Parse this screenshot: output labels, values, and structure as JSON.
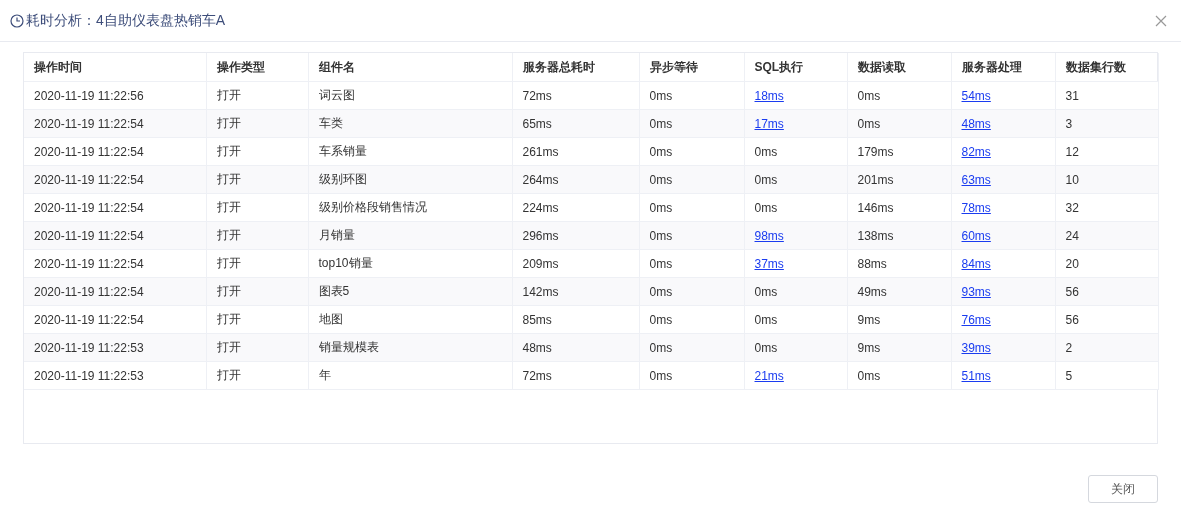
{
  "dialog": {
    "title": "耗时分析：4自助仪表盘热销车A"
  },
  "table": {
    "columns": [
      "操作时间",
      "操作类型",
      "组件名",
      "服务器总耗时",
      "异步等待",
      "SQL执行",
      "数据读取",
      "服务器处理",
      "数据集行数"
    ],
    "rows": [
      {
        "cells": [
          {
            "text": "2020-11-19 11:22:56",
            "link": false
          },
          {
            "text": "打开",
            "link": false
          },
          {
            "text": "词云图",
            "link": false
          },
          {
            "text": "72ms",
            "link": false
          },
          {
            "text": "0ms",
            "link": false
          },
          {
            "text": "18ms",
            "link": true
          },
          {
            "text": "0ms",
            "link": false
          },
          {
            "text": "54ms",
            "link": true
          },
          {
            "text": "31",
            "link": false
          }
        ]
      },
      {
        "cells": [
          {
            "text": "2020-11-19 11:22:54",
            "link": false
          },
          {
            "text": "打开",
            "link": false
          },
          {
            "text": "车类",
            "link": false
          },
          {
            "text": "65ms",
            "link": false
          },
          {
            "text": "0ms",
            "link": false
          },
          {
            "text": "17ms",
            "link": true
          },
          {
            "text": "0ms",
            "link": false
          },
          {
            "text": "48ms",
            "link": true
          },
          {
            "text": "3",
            "link": false
          }
        ]
      },
      {
        "cells": [
          {
            "text": "2020-11-19 11:22:54",
            "link": false
          },
          {
            "text": "打开",
            "link": false
          },
          {
            "text": "车系销量",
            "link": false
          },
          {
            "text": "261ms",
            "link": false
          },
          {
            "text": "0ms",
            "link": false
          },
          {
            "text": "0ms",
            "link": false
          },
          {
            "text": "179ms",
            "link": false
          },
          {
            "text": "82ms",
            "link": true
          },
          {
            "text": "12",
            "link": false
          }
        ]
      },
      {
        "cells": [
          {
            "text": "2020-11-19 11:22:54",
            "link": false
          },
          {
            "text": "打开",
            "link": false
          },
          {
            "text": "级别环图",
            "link": false
          },
          {
            "text": "264ms",
            "link": false
          },
          {
            "text": "0ms",
            "link": false
          },
          {
            "text": "0ms",
            "link": false
          },
          {
            "text": "201ms",
            "link": false
          },
          {
            "text": "63ms",
            "link": true
          },
          {
            "text": "10",
            "link": false
          }
        ]
      },
      {
        "cells": [
          {
            "text": "2020-11-19 11:22:54",
            "link": false
          },
          {
            "text": "打开",
            "link": false
          },
          {
            "text": "级别价格段销售情况",
            "link": false
          },
          {
            "text": "224ms",
            "link": false
          },
          {
            "text": "0ms",
            "link": false
          },
          {
            "text": "0ms",
            "link": false
          },
          {
            "text": "146ms",
            "link": false
          },
          {
            "text": "78ms",
            "link": true
          },
          {
            "text": "32",
            "link": false
          }
        ]
      },
      {
        "cells": [
          {
            "text": "2020-11-19 11:22:54",
            "link": false
          },
          {
            "text": "打开",
            "link": false
          },
          {
            "text": "月销量",
            "link": false
          },
          {
            "text": "296ms",
            "link": false
          },
          {
            "text": "0ms",
            "link": false
          },
          {
            "text": "98ms",
            "link": true
          },
          {
            "text": "138ms",
            "link": false
          },
          {
            "text": "60ms",
            "link": true
          },
          {
            "text": "24",
            "link": false
          }
        ]
      },
      {
        "cells": [
          {
            "text": "2020-11-19 11:22:54",
            "link": false
          },
          {
            "text": "打开",
            "link": false
          },
          {
            "text": "top10销量",
            "link": false
          },
          {
            "text": "209ms",
            "link": false
          },
          {
            "text": "0ms",
            "link": false
          },
          {
            "text": "37ms",
            "link": true
          },
          {
            "text": "88ms",
            "link": false
          },
          {
            "text": "84ms",
            "link": true
          },
          {
            "text": "20",
            "link": false
          }
        ]
      },
      {
        "cells": [
          {
            "text": "2020-11-19 11:22:54",
            "link": false
          },
          {
            "text": "打开",
            "link": false
          },
          {
            "text": "图表5",
            "link": false
          },
          {
            "text": "142ms",
            "link": false
          },
          {
            "text": "0ms",
            "link": false
          },
          {
            "text": "0ms",
            "link": false
          },
          {
            "text": "49ms",
            "link": false
          },
          {
            "text": "93ms",
            "link": true
          },
          {
            "text": "56",
            "link": false
          }
        ]
      },
      {
        "cells": [
          {
            "text": "2020-11-19 11:22:54",
            "link": false
          },
          {
            "text": "打开",
            "link": false
          },
          {
            "text": "地图",
            "link": false
          },
          {
            "text": "85ms",
            "link": false
          },
          {
            "text": "0ms",
            "link": false
          },
          {
            "text": "0ms",
            "link": false
          },
          {
            "text": "9ms",
            "link": false
          },
          {
            "text": "76ms",
            "link": true
          },
          {
            "text": "56",
            "link": false
          }
        ]
      },
      {
        "cells": [
          {
            "text": "2020-11-19 11:22:53",
            "link": false
          },
          {
            "text": "打开",
            "link": false
          },
          {
            "text": "销量规模表",
            "link": false
          },
          {
            "text": "48ms",
            "link": false
          },
          {
            "text": "0ms",
            "link": false
          },
          {
            "text": "0ms",
            "link": false
          },
          {
            "text": "9ms",
            "link": false
          },
          {
            "text": "39ms",
            "link": true
          },
          {
            "text": "2",
            "link": false
          }
        ]
      },
      {
        "cells": [
          {
            "text": "2020-11-19 11:22:53",
            "link": false
          },
          {
            "text": "打开",
            "link": false
          },
          {
            "text": "年",
            "link": false
          },
          {
            "text": "72ms",
            "link": false
          },
          {
            "text": "0ms",
            "link": false
          },
          {
            "text": "21ms",
            "link": true
          },
          {
            "text": "0ms",
            "link": false
          },
          {
            "text": "51ms",
            "link": true
          },
          {
            "text": "5",
            "link": false
          }
        ]
      }
    ]
  },
  "buttons": [
    "关闭"
  ]
}
